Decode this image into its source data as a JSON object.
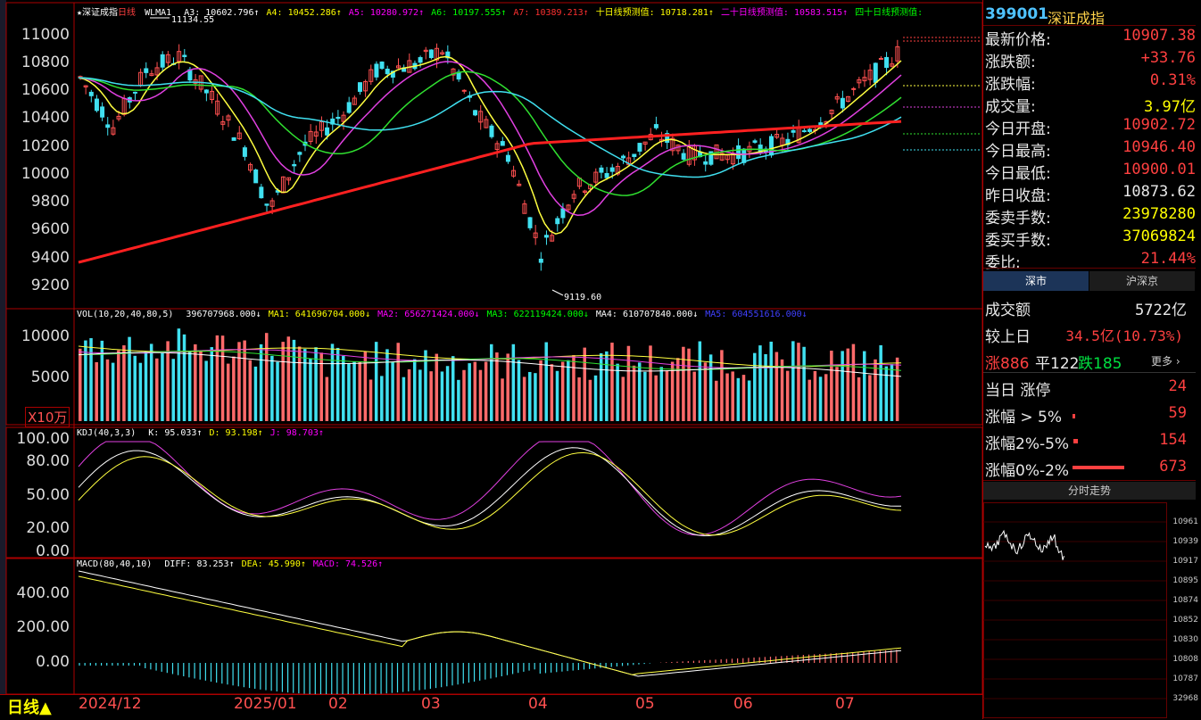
{
  "main_chart": {
    "title": "★深证成指",
    "period": "日线",
    "indicator": "WLMA1",
    "ma_items": [
      {
        "label": "A3: 10602.796↑",
        "color": "#ffffff"
      },
      {
        "label": "A4: 10452.286↑",
        "color": "#ffff00"
      },
      {
        "label": "A5: 10280.972↑",
        "color": "#ff00ff"
      },
      {
        "label": "A6: 10197.555↑",
        "color": "#00ff00"
      },
      {
        "label": "A7: 10389.213↑",
        "color": "#ff3030"
      },
      {
        "label": "十日线预测值: 10718.281↑",
        "color": "#ffff00"
      },
      {
        "label": "二十日线预测值: 10583.515↑",
        "color": "#ff00ff"
      },
      {
        "label": "四十日线预测值:",
        "color": "#00ff00"
      }
    ],
    "y_ticks": [
      "11000",
      "10800",
      "10600",
      "10400",
      "10200",
      "10000",
      "9800",
      "9600",
      "9400",
      "9200"
    ],
    "high_mark": "11134.55",
    "low_mark": "9119.60"
  },
  "vol_panel": {
    "label": "VOL(10,20,40,80,5)",
    "items": [
      {
        "label": "396707968.000↓",
        "color": "#ffffff"
      },
      {
        "label": "MA1: 641696704.000↓",
        "color": "#ffff00"
      },
      {
        "label": "MA2: 656271424.000↓",
        "color": "#ff00ff"
      },
      {
        "label": "MA3: 622119424.000↓",
        "color": "#00ff00"
      },
      {
        "label": "MA4: 610707840.000↓",
        "color": "#ffffff"
      },
      {
        "label": "MA5: 604551616.000↓",
        "color": "#4040ff"
      }
    ],
    "y_ticks": [
      "10000",
      "5000"
    ],
    "unit": "X10万"
  },
  "kdj_panel": {
    "label": "KDJ(40,3,3)",
    "items": [
      {
        "label": "K: 95.033↑",
        "color": "#ffffff"
      },
      {
        "label": "D: 93.198↑",
        "color": "#ffff00"
      },
      {
        "label": "J: 98.703↑",
        "color": "#ff00ff"
      }
    ],
    "y_ticks": [
      "100.00",
      "80.00",
      "50.00",
      "20.00",
      "0.00"
    ]
  },
  "macd_panel": {
    "label": "MACD(80,40,10)",
    "items": [
      {
        "label": "DIFF: 83.253↑",
        "color": "#ffffff"
      },
      {
        "label": "DEA: 45.990↑",
        "color": "#ffff00"
      },
      {
        "label": "MACD: 74.526↑",
        "color": "#ff00ff"
      }
    ],
    "y_ticks": [
      "400.00",
      "200.00",
      "0.00"
    ]
  },
  "x_axis": {
    "period_label": "日线▲",
    "months": [
      "2024/12",
      "2025/01",
      "02",
      "03",
      "04",
      "05",
      "06",
      "07"
    ]
  },
  "quote": {
    "code": "399001",
    "name": "深证成指",
    "rows": [
      {
        "label": "最新价格:",
        "value": "10907.38",
        "color": "#ff4040"
      },
      {
        "label": "涨跌额:",
        "value": "+33.76",
        "color": "#ff4040"
      },
      {
        "label": "涨跌幅:",
        "value": "0.31%",
        "color": "#ff4040"
      },
      {
        "label": "成交量:",
        "value": "3.97亿",
        "color": "#ffff00"
      },
      {
        "label": "今日开盘:",
        "value": "10902.72",
        "color": "#ff4040"
      },
      {
        "label": "今日最高:",
        "value": "10946.40",
        "color": "#ff4040"
      },
      {
        "label": "今日最低:",
        "value": "10900.01",
        "color": "#ff4040"
      },
      {
        "label": "昨日收盘:",
        "value": "10873.62",
        "color": "#e8e8e8"
      },
      {
        "label": "委卖手数:",
        "value": "23978280",
        "color": "#ffff00"
      },
      {
        "label": "委买手数:",
        "value": "37069824",
        "color": "#ffff00"
      },
      {
        "label": "委比:",
        "value": "21.44%",
        "color": "#ff4040"
      }
    ]
  },
  "tabs": {
    "active": "深市",
    "inactive": "沪深京"
  },
  "market": {
    "turnover_label": "成交额",
    "turnover": "5722亿",
    "vs_prev_label": "较上日",
    "vs_prev": "34.5亿(10.73%)",
    "up": "涨886",
    "flat": "平122",
    "down": "跌185",
    "more": "更多 ›",
    "limit_label": "当日 涨停",
    "limit_value": "24",
    "gt5_label": "涨幅 > 5%",
    "gt5_value": "59",
    "r25_label": "涨幅2%-5%",
    "r25_value": "154",
    "r02_label": "涨幅0%-2%",
    "r02_value": "673"
  },
  "mini": {
    "title": "分时走势",
    "y_ticks": [
      "10961",
      "10939",
      "10917",
      "10895",
      "10874",
      "10852",
      "10830",
      "10808",
      "10787",
      "32968"
    ]
  }
}
